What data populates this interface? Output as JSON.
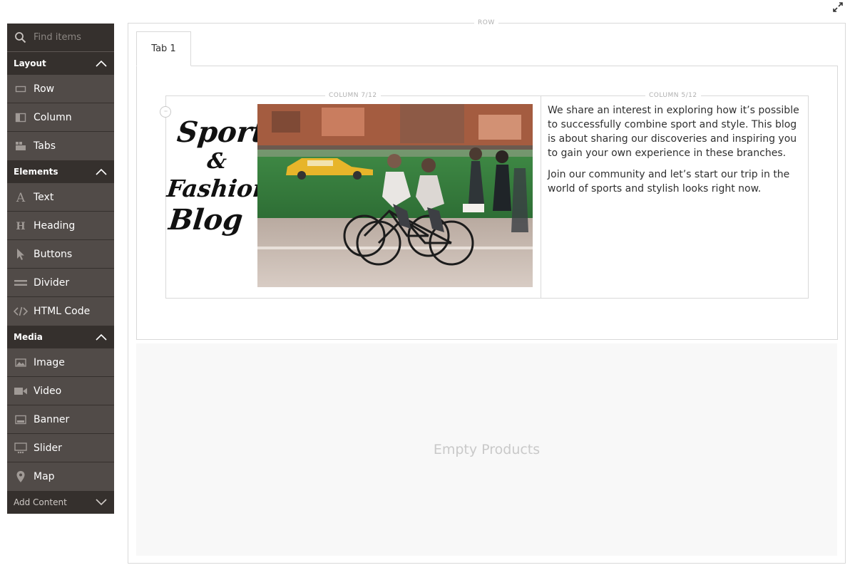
{
  "sidebar": {
    "search": {
      "placeholder": "Find items"
    },
    "groups": [
      {
        "title": "Layout",
        "items": [
          {
            "label": "Row",
            "icon": "row-icon"
          },
          {
            "label": "Column",
            "icon": "column-icon"
          },
          {
            "label": "Tabs",
            "icon": "tabs-icon"
          }
        ]
      },
      {
        "title": "Elements",
        "items": [
          {
            "label": "Text",
            "icon": "text-icon"
          },
          {
            "label": "Heading",
            "icon": "heading-icon"
          },
          {
            "label": "Buttons",
            "icon": "cursor-icon"
          },
          {
            "label": "Divider",
            "icon": "divider-icon"
          },
          {
            "label": "HTML Code",
            "icon": "code-icon"
          }
        ]
      },
      {
        "title": "Media",
        "items": [
          {
            "label": "Image",
            "icon": "image-icon"
          },
          {
            "label": "Video",
            "icon": "video-icon"
          },
          {
            "label": "Banner",
            "icon": "banner-icon"
          },
          {
            "label": "Slider",
            "icon": "slider-icon"
          },
          {
            "label": "Map",
            "icon": "map-pin-icon"
          }
        ]
      }
    ],
    "add_content": "Add Content"
  },
  "stage": {
    "row_label": "ROW",
    "tabs": [
      {
        "label": "Tab 1"
      }
    ],
    "columns": [
      {
        "label": "COLUMN 7/12"
      },
      {
        "label": "COLUMN 5/12"
      }
    ],
    "image_title": [
      "Sport",
      "&",
      "Fashion",
      "Blog"
    ],
    "text_paragraphs": [
      "We share an interest in exploring how it’s possible to successfully combine sport and style. This blog is about sharing our discoveries and inspiring you to gain your own experience in these branches.",
      "Join our community and let’s start our trip in the world of sports and stylish looks right now."
    ],
    "products_placeholder": "Empty Products"
  },
  "colors": {
    "sidebar_bg": "#4a4542",
    "sidebar_header_bg": "#35302d",
    "border": "#d9d9d9"
  }
}
